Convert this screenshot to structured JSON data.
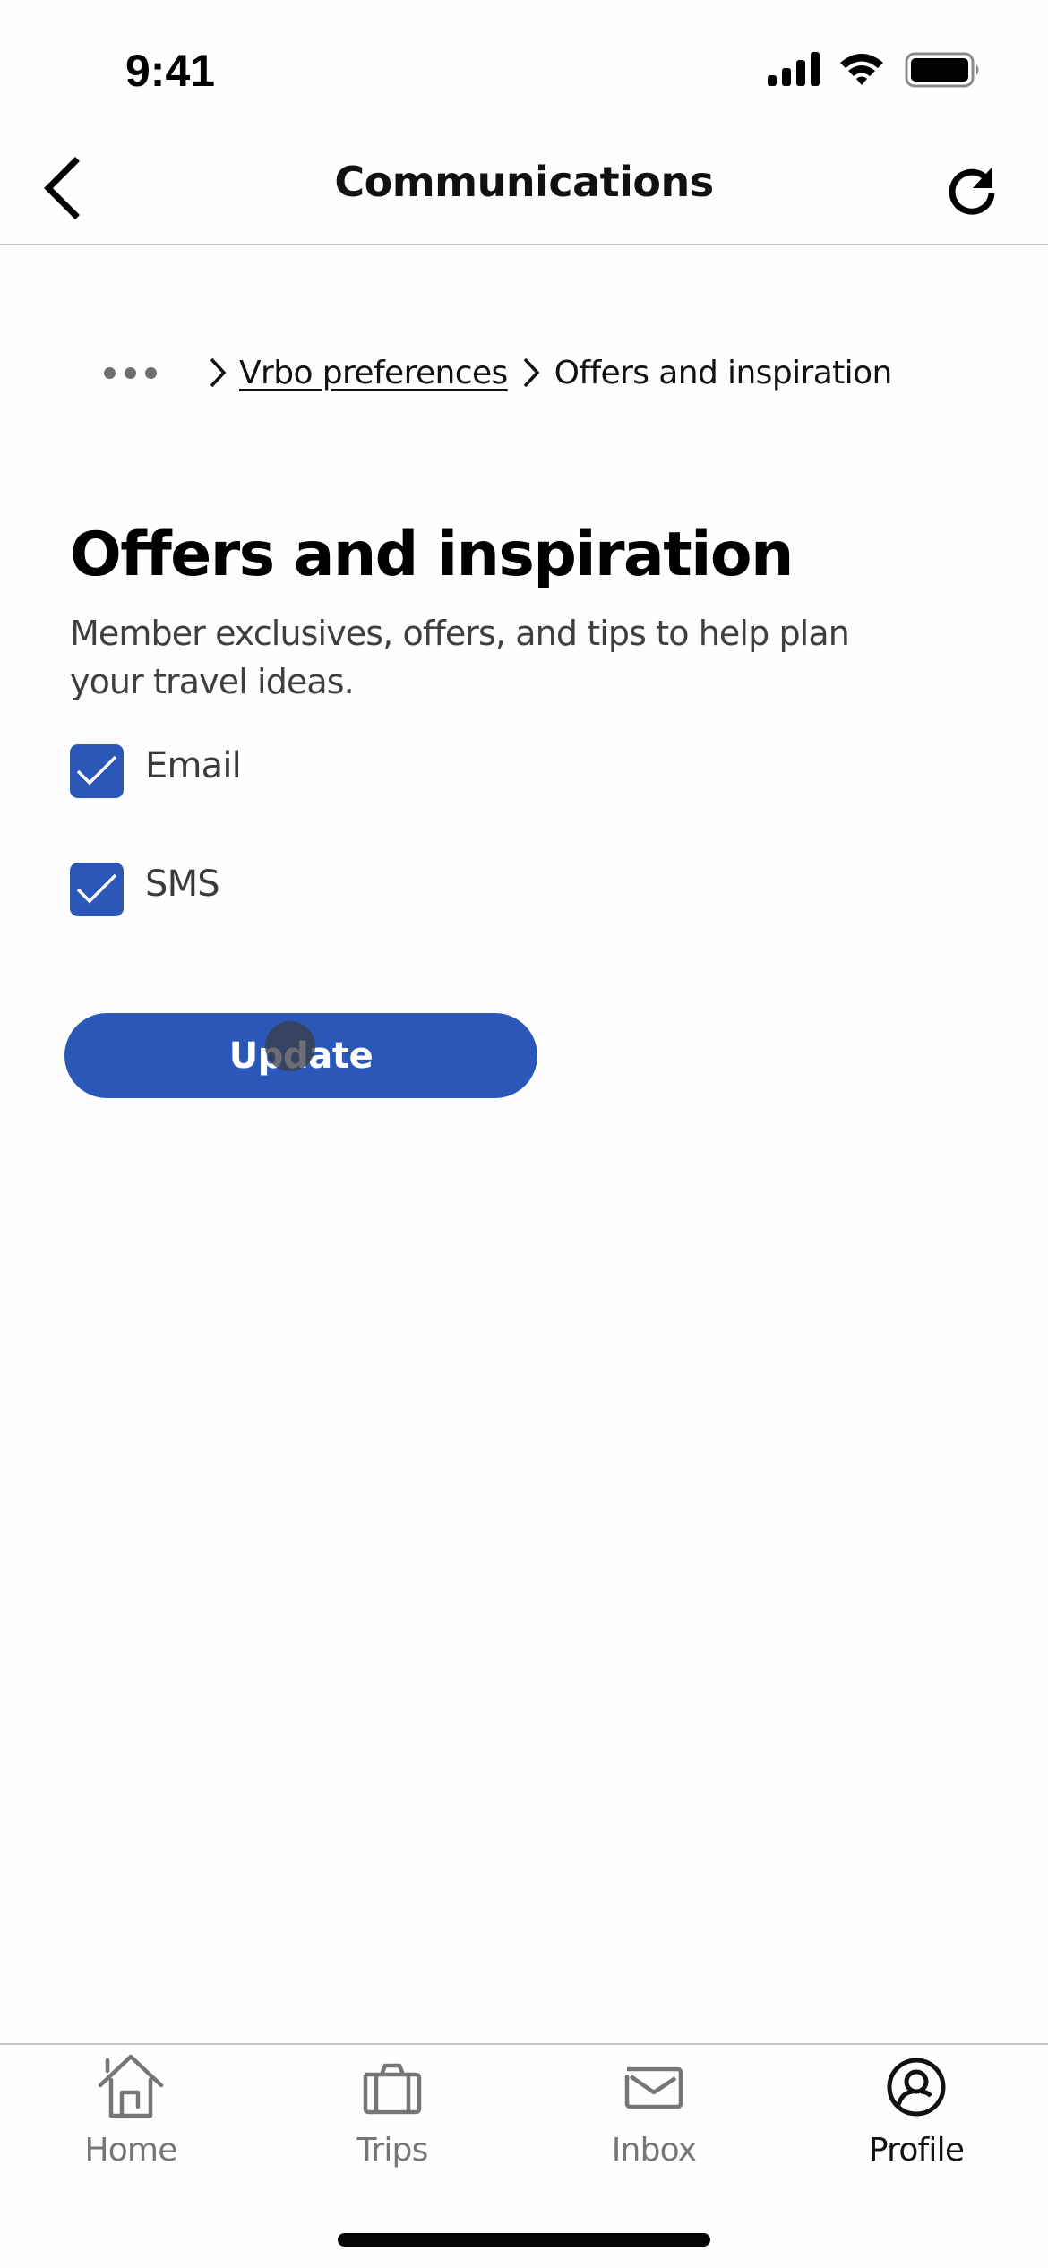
{
  "status_bar": {
    "time": "9:41",
    "icons": [
      "cellular-signal-icon",
      "wifi-icon",
      "battery-icon"
    ]
  },
  "header": {
    "title": "Communications",
    "back_icon": "chevron-left-icon",
    "refresh_icon": "refresh-icon"
  },
  "breadcrumb": {
    "more_icon": "ellipsis-icon",
    "items": [
      {
        "label": "Vrbo preferences",
        "link": true
      },
      {
        "label": "Offers and inspiration",
        "link": false
      }
    ]
  },
  "main": {
    "title": "Offers and inspiration",
    "description": "Member exclusives, offers, and tips to help plan your travel ideas.",
    "options": [
      {
        "label": "Email",
        "checked": true
      },
      {
        "label": "SMS",
        "checked": true
      }
    ],
    "update_label": "Update"
  },
  "tabs": [
    {
      "label": "Home",
      "icon": "home-icon",
      "active": false
    },
    {
      "label": "Trips",
      "icon": "suitcase-icon",
      "active": false
    },
    {
      "label": "Inbox",
      "icon": "envelope-icon",
      "active": false
    },
    {
      "label": "Profile",
      "icon": "profile-icon",
      "active": true
    }
  ],
  "colors": {
    "accent": "#2b58b8",
    "text_primary": "#111111",
    "text_secondary": "#3f3f3f",
    "tab_inactive": "#767676",
    "separator": "#c4c4c4"
  }
}
